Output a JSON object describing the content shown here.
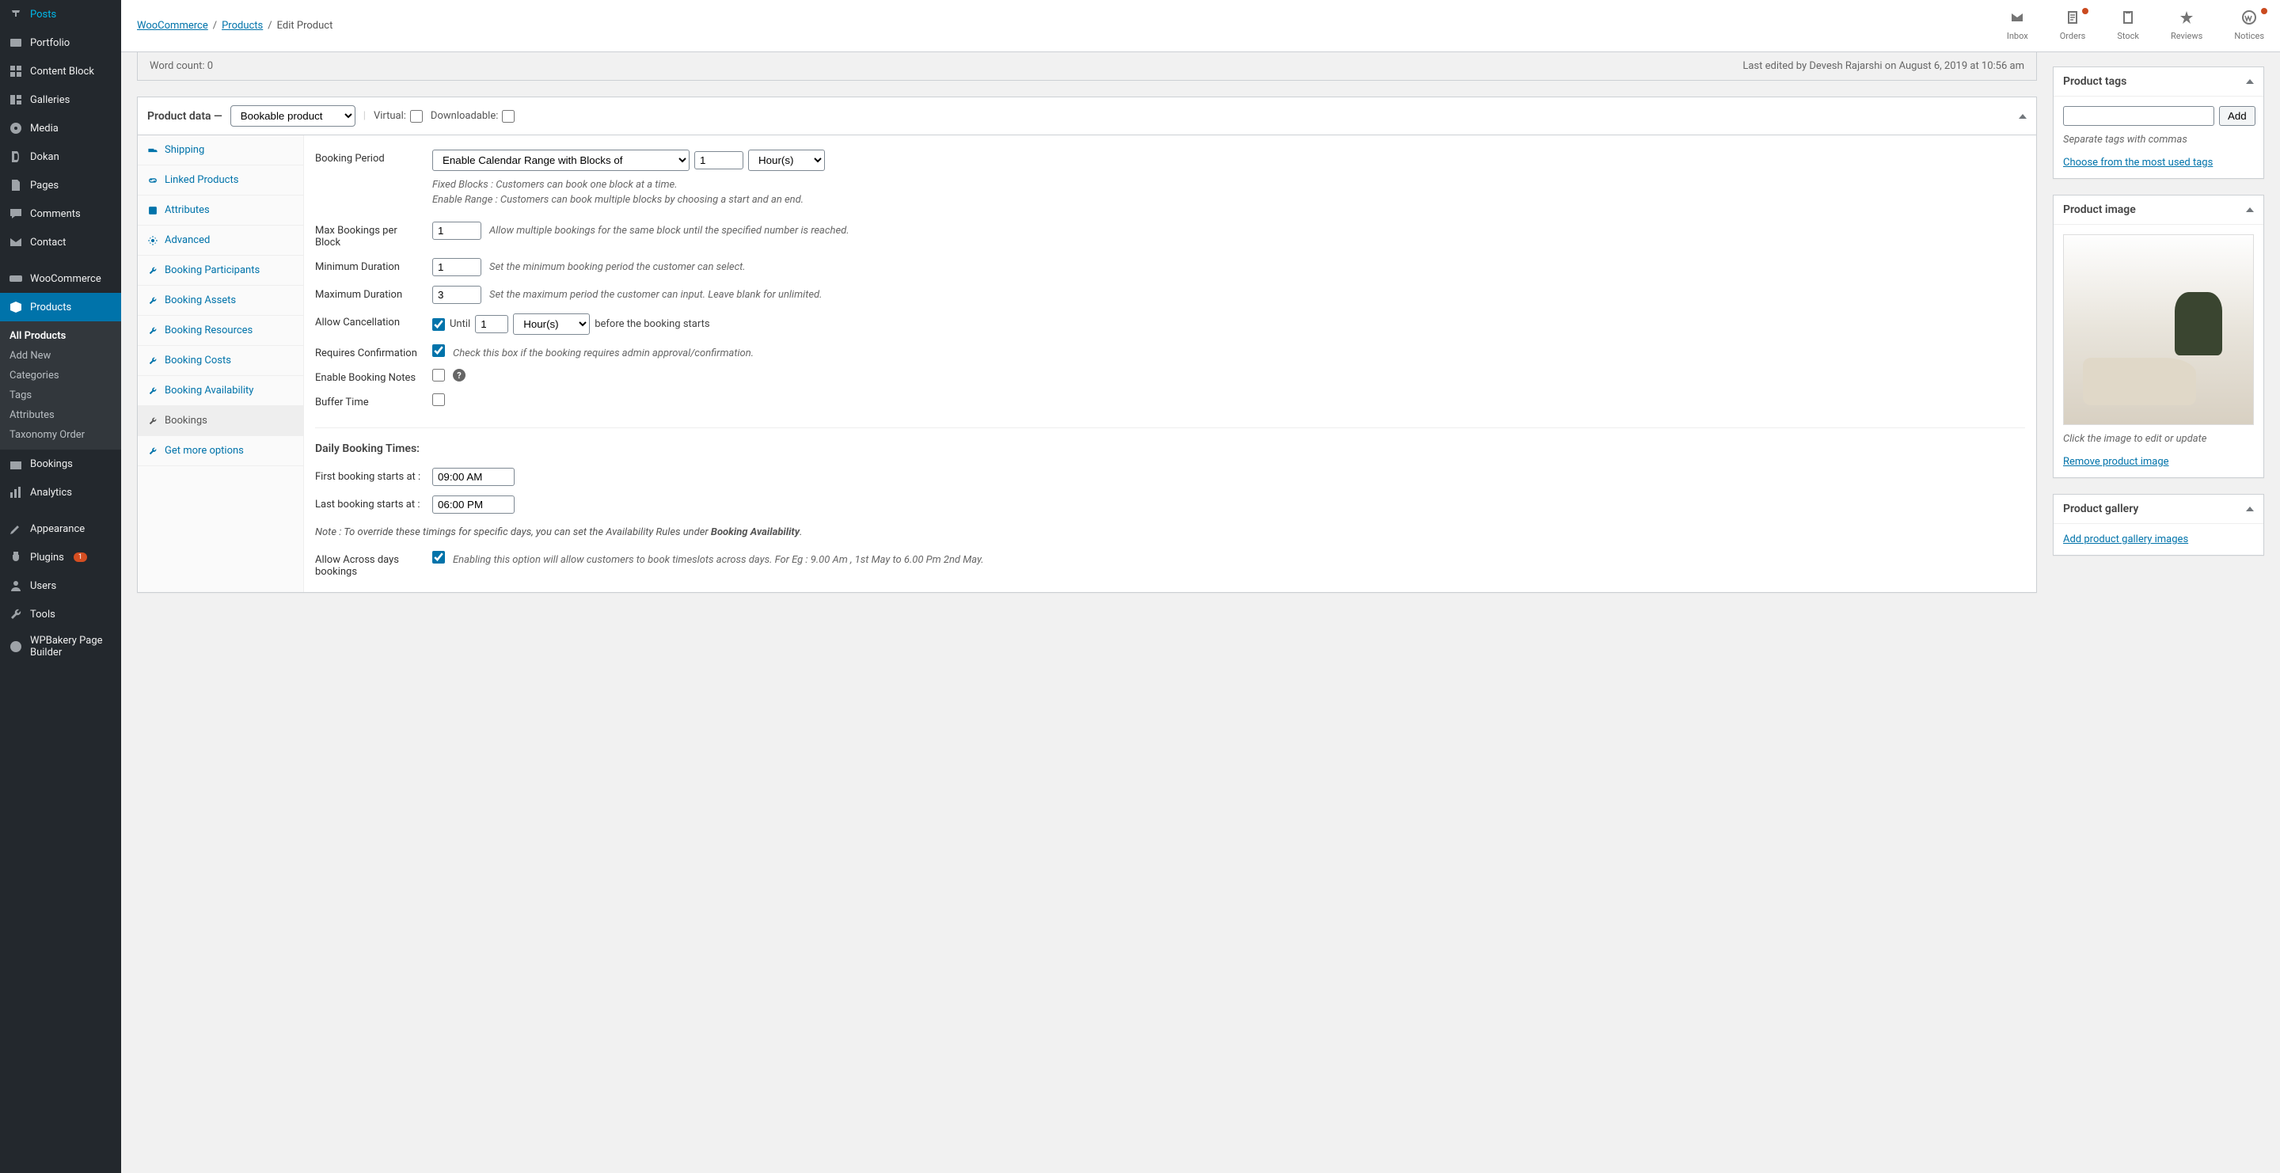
{
  "breadcrumb": {
    "l1": "WooCommerce",
    "l2": "Products",
    "l3": "Edit Product"
  },
  "topbar": {
    "inbox": "Inbox",
    "orders": "Orders",
    "stock": "Stock",
    "reviews": "Reviews",
    "notices": "Notices"
  },
  "sidebar": {
    "posts": "Posts",
    "portfolio": "Portfolio",
    "contentblock": "Content Block",
    "galleries": "Galleries",
    "media": "Media",
    "dokan": "Dokan",
    "pages": "Pages",
    "comments": "Comments",
    "contact": "Contact",
    "woocommerce": "WooCommerce",
    "products": "Products",
    "bookings": "Bookings",
    "analytics": "Analytics",
    "appearance": "Appearance",
    "plugins": "Plugins",
    "plugins_badge": "1",
    "users": "Users",
    "tools": "Tools",
    "wpbakery": "WPBakery Page Builder",
    "sub": {
      "all": "All Products",
      "add": "Add New",
      "cat": "Categories",
      "tags": "Tags",
      "attr": "Attributes",
      "tax": "Taxonomy Order"
    }
  },
  "wordcount": {
    "left": "Word count: 0",
    "right": "Last edited by Devesh Rajarshi on August 6, 2019 at 10:56 am"
  },
  "pdata": {
    "title": "Product data —",
    "type": "Bookable product",
    "virtual_lbl": "Virtual:",
    "downloadable_lbl": "Downloadable:",
    "tabs": {
      "shipping": "Shipping",
      "linked": "Linked Products",
      "attributes": "Attributes",
      "advanced": "Advanced",
      "participants": "Booking Participants",
      "assets": "Booking Assets",
      "resources": "Booking Resources",
      "costs": "Booking Costs",
      "availability": "Booking Availability",
      "bookings": "Bookings",
      "getmore": "Get more options"
    }
  },
  "fields": {
    "booking_period_lbl": "Booking Period",
    "booking_period_sel": "Enable Calendar Range with Blocks of",
    "blocks_val": "1",
    "unit_sel": "Hour(s)",
    "hint_fixed": "Fixed Blocks : Customers can book one block at a time.",
    "hint_range": "Enable Range : Customers can book multiple blocks by choosing a start and an end.",
    "max_lbl": "Max Bookings per Block",
    "max_val": "1",
    "max_desc": "Allow multiple bookings for the same block until the specified number is reached.",
    "min_lbl": "Minimum Duration",
    "min_val": "1",
    "min_desc": "Set the minimum booking period the customer can select.",
    "maxd_lbl": "Maximum Duration",
    "maxd_val": "3",
    "maxd_desc": "Set the maximum period the customer can input. Leave blank for unlimited.",
    "cancel_lbl": "Allow Cancellation",
    "cancel_until": "Until",
    "cancel_val": "1",
    "cancel_unit": "Hour(s)",
    "cancel_after": "before the booking starts",
    "confirm_lbl": "Requires Confirmation",
    "confirm_desc": "Check this box if the booking requires admin approval/confirmation.",
    "notes_lbl": "Enable Booking Notes",
    "buffer_lbl": "Buffer Time",
    "daily_h": "Daily Booking Times:",
    "first_lbl": "First booking starts at :",
    "first_val": "09:00 AM",
    "last_lbl": "Last booking starts at :",
    "last_val": "06:00 PM",
    "note_pre": "Note : To override these timings for specific days, you can set the Availability Rules under ",
    "note_bold": "Booking Availability",
    "across_lbl": "Allow Across days bookings",
    "across_desc": "Enabling this option will allow customers to book timeslots across days. For Eg : 9.00 Am , 1st May to 6.00 Pm 2nd May."
  },
  "tags_panel": {
    "title": "Product tags",
    "add_btn": "Add",
    "hint": "Separate tags with commas",
    "choose": "Choose from the most used tags"
  },
  "image_panel": {
    "title": "Product image",
    "click": "Click the image to edit or update",
    "remove": "Remove product image"
  },
  "gallery_panel": {
    "title": "Product gallery",
    "add": "Add product gallery images"
  }
}
